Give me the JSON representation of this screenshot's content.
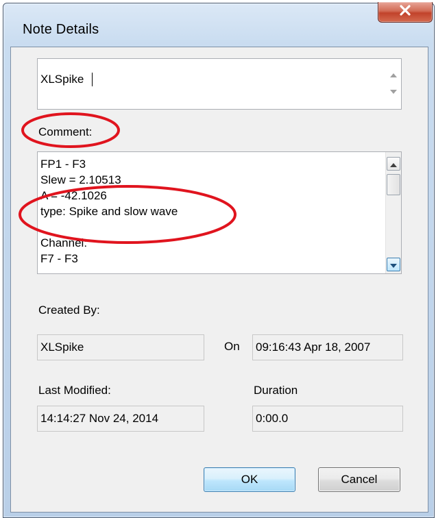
{
  "window": {
    "title": "Note Details"
  },
  "note": {
    "text": "XLSpike"
  },
  "comment": {
    "label": "Comment:",
    "lines": [
      "FP1 - F3",
      "Slew = 2.10513",
      "A = -42.1026",
      "type: Spike and slow wave",
      "",
      "Channel:",
      "F7 - F3"
    ]
  },
  "created": {
    "label": "Created By:",
    "by": "XLSpike",
    "on_label": "On",
    "timestamp": "09:16:43 Apr 18, 2007"
  },
  "modified": {
    "label": "Last Modified:",
    "timestamp": "14:14:27 Nov 24, 2014"
  },
  "duration": {
    "label": "Duration",
    "value": "0:00.0"
  },
  "buttons": {
    "ok": "OK",
    "cancel": "Cancel"
  },
  "annotation_color": "#e0141e"
}
